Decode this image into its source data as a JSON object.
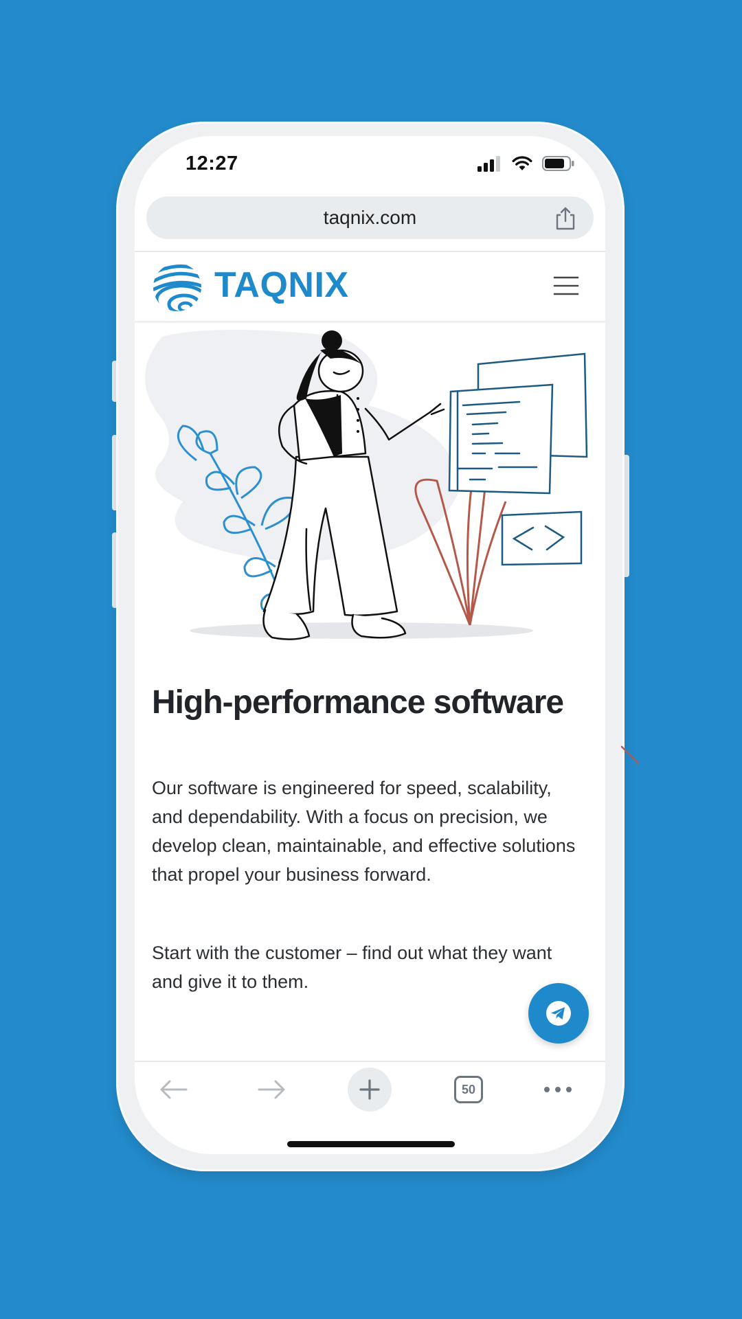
{
  "status_bar": {
    "time": "12:27"
  },
  "browser": {
    "url": "taqnix.com"
  },
  "site": {
    "brand": "TAQNIX"
  },
  "content": {
    "heading": "High-performance software",
    "paragraph_1": "Our software is engineered for speed, scalability, and dependability. With a focus on precision, we develop clean, maintainable, and effective solutions that propel your business forward.",
    "paragraph_2": "Start with the customer – find out what they want and give it to them."
  },
  "toolbar": {
    "tabs_count": "50"
  },
  "colors": {
    "background": "#238bcc",
    "brand": "#1f8acb",
    "plant_red": "#b5584a",
    "screen": "#ffffff"
  },
  "icons": [
    "signal-icon",
    "wifi-icon",
    "battery-icon",
    "share-icon",
    "logo-globe-icon",
    "hamburger-menu-icon",
    "telegram-icon",
    "back-arrow-icon",
    "forward-arrow-icon",
    "plus-icon",
    "tabs-icon",
    "more-icon"
  ]
}
